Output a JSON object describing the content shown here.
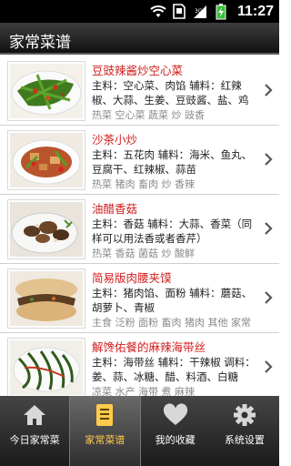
{
  "status_bar": {
    "time": "11:27",
    "icons": [
      "wifi-icon",
      "sd-card-icon",
      "cell-signal-icon",
      "battery-charging-icon"
    ]
  },
  "header": {
    "title": "家常菜谱"
  },
  "recipes": [
    {
      "title": "豆豉辣酱炒空心菜",
      "desc": "主料：空心菜、肉馅  辅料：红辣椒、大蒜、生姜、豆豉酱、盐、鸡精",
      "tags": "热菜 空心菜 蔬菜 炒 豉香",
      "image": "stir-fried-water-spinach-photo"
    },
    {
      "title": "沙茶小炒",
      "desc": "主料：五花肉  辅料：海米、鱼丸、豆腐干、红辣椒、蒜苗",
      "tags": "热菜 猪肉 畜肉 炒 香辣",
      "image": "shacha-stir-fry-photo"
    },
    {
      "title": "油醋香菇",
      "desc": "主料：香菇  辅料：大蒜、香菜（同样可以用法香或者香芹）",
      "tags": "热菜 香菇 菌菇 炒 酸鲜",
      "image": "vinegar-mushroom-photo"
    },
    {
      "title": "简易版肉腰夹馍",
      "desc": "主料：猪肉馅、面粉  辅料：蘑菇、胡萝卜、青椒",
      "tags": "主食 泛粉 面粉 畜肉 猪肉 其他 家常",
      "image": "meat-sandwich-bun-photo"
    },
    {
      "title": "解馋佑餐的麻辣海带丝",
      "desc": "主料：海带丝  辅料：干辣椒  调料：姜、蒜、冰糖、醋、料酒、白糖",
      "tags": "凉菜 水产 海带 煮 麻辣",
      "image": "spicy-kelp-shreds-photo"
    }
  ],
  "bottom_nav": [
    {
      "label": "今日家常菜",
      "icon": "home-icon",
      "active": false
    },
    {
      "label": "家常菜谱",
      "icon": "recipe-list-icon",
      "active": true
    },
    {
      "label": "我的收藏",
      "icon": "heart-icon",
      "active": false
    },
    {
      "label": "系统设置",
      "icon": "gear-icon",
      "active": false
    }
  ],
  "colors": {
    "recipe_title": "#cf1d1d",
    "active_tab_label": "#ffcb4d",
    "tags": "#8a8a8a"
  }
}
